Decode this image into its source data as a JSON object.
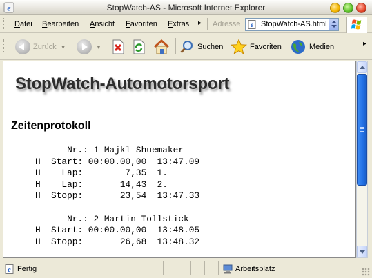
{
  "window": {
    "title": "StopWatch-AS - Microsoft Internet Explorer"
  },
  "menu": {
    "items": [
      "Datei",
      "Bearbeiten",
      "Ansicht",
      "Favoriten",
      "Extras"
    ],
    "more": "▸",
    "address_label": "Adresse",
    "address_value": "StopWatch-AS.html"
  },
  "toolbar": {
    "back_label": "Zurück",
    "search_label": "Suchen",
    "favorites_label": "Favoriten",
    "media_label": "Medien",
    "more": "▸"
  },
  "page": {
    "heading": "StopWatch-Automotorsport",
    "subheading": "Zeitenprotokoll",
    "log_lines": [
      "      Nr.: 1 Majkl Shuemaker",
      "H  Start: 00:00.00,00  13:47.09",
      "H    Lap:        7,35  1.",
      "H    Lap:       14,43  2.",
      "H  Stopp:       23,54  13:47.33",
      "",
      "      Nr.: 2 Martin Tollstick",
      "H  Start: 00:00.00,00  13:48.05",
      "H  Stopp:       26,68  13:48.32"
    ]
  },
  "status": {
    "left_text": "Fertig",
    "zone_text": "Arbeitsplatz"
  },
  "colors": {
    "xp_face": "#ECE9D8",
    "scroll_blue": "#2372E6"
  }
}
